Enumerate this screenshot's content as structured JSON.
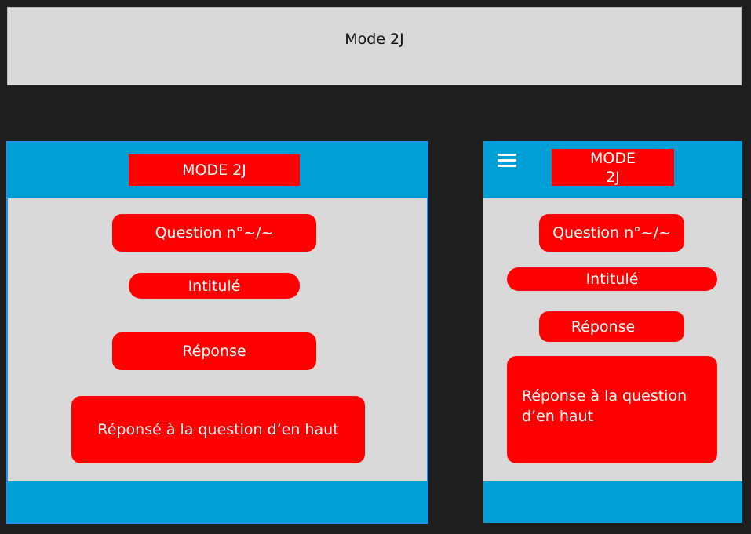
{
  "page_title": "Mode 2J",
  "desktop": {
    "header_label": "MODE 2J",
    "question_label": "Question n°~/~",
    "intitule_label": "Intitulé",
    "reponse_label": "Réponse",
    "answer_text": "Réponsé à la question d’en haut"
  },
  "mobile": {
    "menu_icon": "hamburger-menu-icon",
    "header_line1": "MODE",
    "header_line2": "2J",
    "question_label": "Question n°~/~",
    "intitule_label": "Intitulé",
    "reponse_label": "Réponse",
    "answer_line1": "Réponse à la question",
    "answer_line2": "d’en haut"
  },
  "colors": {
    "background": "#1e1e1e",
    "frame_blue": "#009fd6",
    "panel_grey": "#d9d9d9",
    "accent_red": "#ff0000"
  }
}
